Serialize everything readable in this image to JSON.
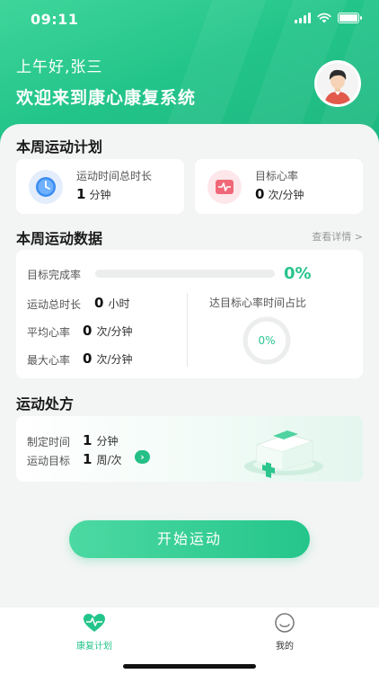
{
  "status_bar": {
    "time": "09:11"
  },
  "header": {
    "greeting": "上午好,张三",
    "welcome": "欢迎来到康心康复系统"
  },
  "weekly_plan": {
    "title": "本周运动计划",
    "duration": {
      "label": "运动时间总时长",
      "value": "1",
      "unit": "分钟",
      "icon": "clock-icon"
    },
    "heart_rate": {
      "label": "目标心率",
      "value": "0",
      "unit": "次/分钟",
      "icon": "heart-monitor-icon"
    }
  },
  "weekly_data": {
    "title": "本周运动数据",
    "details_link": "查看详情 >",
    "completion_label": "目标完成率",
    "completion_percent": "0%",
    "completion_fraction": 0,
    "total_duration": {
      "label": "运动总时长",
      "value": "0",
      "unit": "小时"
    },
    "avg_heart_rate": {
      "label": "平均心率",
      "value": "0",
      "unit": "次/分钟"
    },
    "max_heart_rate": {
      "label": "最大心率",
      "value": "0",
      "unit": "次/分钟"
    },
    "target_hr_ratio": {
      "label": "达目标心率时间占比",
      "value": "0%"
    }
  },
  "prescription": {
    "title": "运动处方",
    "set_time": {
      "label": "制定时间",
      "value": "1",
      "unit": "分钟"
    },
    "goal": {
      "label": "运动目标",
      "value": "1",
      "unit": "周/次"
    }
  },
  "start_button": "开始运动",
  "tabbar": {
    "items": [
      {
        "label": "康复计划",
        "active": true
      },
      {
        "label": "我的",
        "active": false
      }
    ]
  },
  "colors": {
    "accent": "#24c58b",
    "accent_light": "#4cd9a2"
  }
}
